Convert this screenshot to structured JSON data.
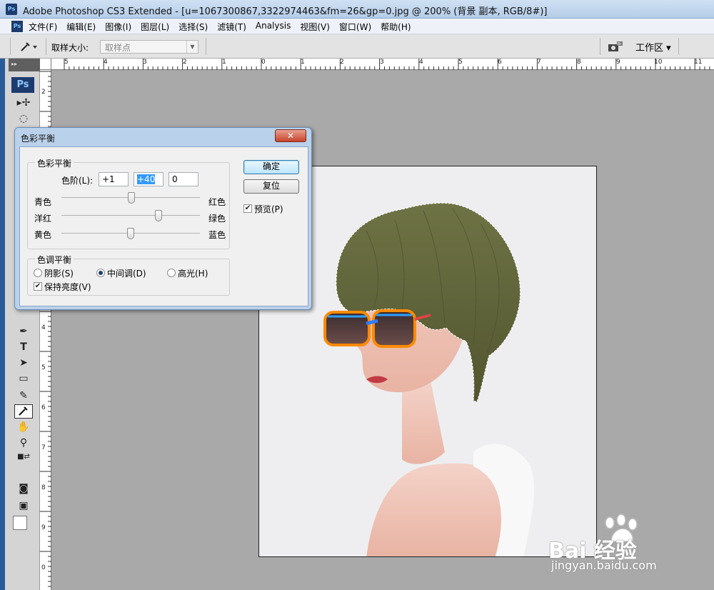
{
  "app": {
    "title": "Adobe Photoshop CS3 Extended - [u=1067300867,3322974463&fm=26&gp=0.jpg @ 200% (背景 副本, RGB/8#)]",
    "logo": "Ps"
  },
  "menu": [
    "文件(F)",
    "编辑(E)",
    "图像(I)",
    "图层(L)",
    "选择(S)",
    "滤镜(T)",
    "Analysis",
    "视图(V)",
    "窗口(W)",
    "帮助(H)"
  ],
  "options": {
    "sample_size_label": "取样大小:",
    "sample_size_value": "取样点",
    "workspace_label": "工作区 ▾"
  },
  "ruler_top": [
    "5",
    "4",
    "3",
    "2",
    "1",
    "0",
    "1",
    "2",
    "3",
    "4",
    "5",
    "6",
    "7",
    "8",
    "9",
    "10",
    "11"
  ],
  "ruler_left": [
    "2",
    "3",
    "4",
    "5",
    "6",
    "7",
    "8",
    "9",
    "0"
  ],
  "dialog": {
    "title": "色彩平衡",
    "close_label": "✕",
    "color_balance_group": "色彩平衡",
    "levels_label": "色阶(L):",
    "level_values": [
      "+1",
      "+40",
      "0"
    ],
    "sliders": [
      {
        "left": "青色",
        "right": "红色",
        "value": 1
      },
      {
        "left": "洋红",
        "right": "绿色",
        "value": 40
      },
      {
        "left": "黄色",
        "right": "蓝色",
        "value": 0
      }
    ],
    "tone_balance_group": "色调平衡",
    "tones": [
      "阴影(S)",
      "中间调(D)",
      "高光(H)"
    ],
    "selected_tone": "中间调(D)",
    "preserve_luminosity": "保持亮度(V)",
    "preserve_checked": true,
    "ok_label": "确定",
    "reset_label": "复位",
    "preview_label": "预览(P)",
    "preview_checked": true
  },
  "watermark": {
    "brand": "Bai 经验",
    "url": "jingyan.baidu.com"
  },
  "colors": {
    "hair": "#6a6e40",
    "canvas_bg": "#eeeef0",
    "workspace": "#a9a9a9"
  }
}
